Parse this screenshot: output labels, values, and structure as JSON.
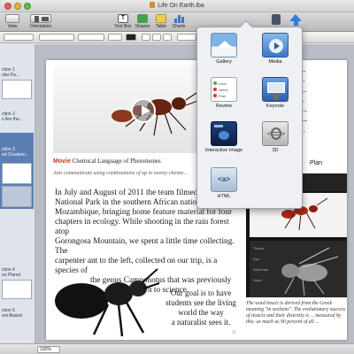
{
  "window": {
    "title": "Life On Earth.iba"
  },
  "toolbar": {
    "view_label": "View",
    "orientation_label": "Orientation",
    "text_box_label": "Text Box",
    "shapes_label": "Shapes",
    "table_label": "Table",
    "charts_label": "Charts"
  },
  "sidebar": {
    "items": [
      {
        "num": "1",
        "lines": [
          "ction 1",
          "ular Pa..."
        ]
      },
      {
        "num": "2",
        "lines": [
          "ction 2",
          "s Are the..."
        ]
      },
      {
        "num": "3",
        "lines": [
          "ction 3",
          "ed Creature..."
        ]
      },
      {
        "num": "4",
        "lines": [
          "ction 4",
          "en Planet"
        ]
      },
      {
        "num": "5",
        "lines": [
          "ction 5",
          "ent-Based"
        ]
      }
    ]
  },
  "popover": {
    "items": [
      {
        "label": "Gallery",
        "icon": "gallery-icon"
      },
      {
        "label": "Media",
        "icon": "media-icon"
      },
      {
        "label": "Review",
        "icon": "review-icon"
      },
      {
        "label": "Keynote",
        "icon": "keynote-icon"
      },
      {
        "label": "Interactive Image",
        "icon": "interactive-image-icon"
      },
      {
        "label": "3D",
        "icon": "3d-icon"
      },
      {
        "label": "HTML",
        "icon": "html-icon"
      }
    ],
    "html_glyph": "<a>",
    "review_rows": [
      "Leon",
      "Jaxon",
      "Poet"
    ]
  },
  "page": {
    "caption_tag": "Movie",
    "caption_text": "Chemical Language of Pheromones",
    "subcaption": "Ants communicate using combinations of up to twenty chemic...",
    "body": [
      "In July and August of 2011 the team filmed in Go...",
      "National Park in the southern African nation of",
      "Mozambique, bringing home feature material for four",
      "chapters in ecology. While shooting in the rain forest atop",
      "Gorongosa Mountain, we spent a little time collecting. The",
      "carpenter ant to the left, collected on our trip, is a species of",
      "the genus Camponotus that was previously",
      "unknown to science."
    ],
    "body2": [
      "Our goal is to have",
      "students see the living",
      "world the way",
      "a naturalist sees it."
    ],
    "right_col": [
      "m, the chemical er...",
      "e plumes of phero...",
      "that organisms use...",
      "study of a living s...",
      "n Lab. A distinguis...",
      "ence specialist in p...",
      "Harvard Universit...",
      "ur Inquiry..."
    ],
    "plan_label": "Plan",
    "diagram_labels": [
      "Thorax",
      "Eye",
      "Antennae",
      "Head"
    ],
    "fig_note": "The word insect is derived from the Greek meaning \"in sections\". The evolutionary success of insects and their diversity is ... measured by this: as much as 90 percent of all ...",
    "page_number": "11"
  },
  "bottom": {
    "zoom": "100%"
  }
}
